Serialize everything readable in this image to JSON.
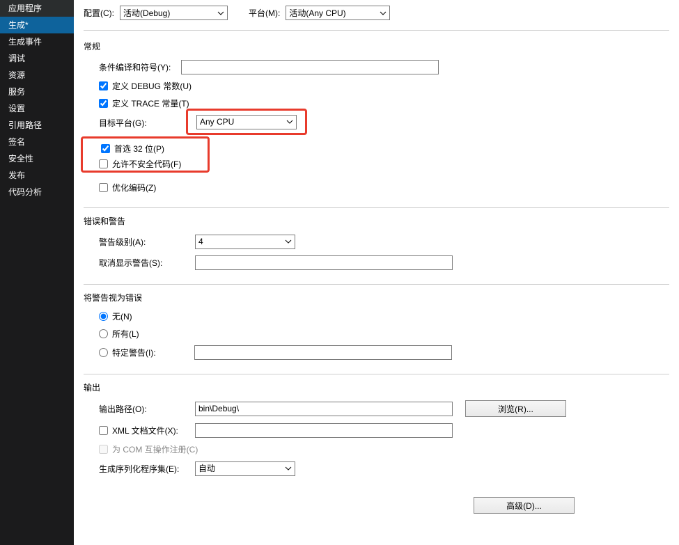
{
  "sidebar": {
    "items": [
      {
        "label": "应用程序"
      },
      {
        "label": "生成*"
      },
      {
        "label": "生成事件"
      },
      {
        "label": "调试"
      },
      {
        "label": "资源"
      },
      {
        "label": "服务"
      },
      {
        "label": "设置"
      },
      {
        "label": "引用路径"
      },
      {
        "label": "签名"
      },
      {
        "label": "安全性"
      },
      {
        "label": "发布"
      },
      {
        "label": "代码分析"
      }
    ]
  },
  "top": {
    "config_label": "配置(C):",
    "config_value": "活动(Debug)",
    "platform_label": "平台(M):",
    "platform_value": "活动(Any CPU)"
  },
  "general": {
    "title": "常规",
    "cond_symbols_label": "条件编译和符号(Y):",
    "cond_symbols_value": "",
    "define_debug": "定义 DEBUG 常数(U)",
    "define_trace": "定义 TRACE 常量(T)",
    "target_platform_label": "目标平台(G):",
    "target_platform_value": "Any CPU",
    "prefer_32bit": "首选 32 位(P)",
    "allow_unsafe": "允许不安全代码(F)",
    "optimize": "优化编码(Z)"
  },
  "warnings": {
    "title": "错误和警告",
    "level_label": "警告级别(A):",
    "level_value": "4",
    "suppress_label": "取消显示警告(S):",
    "suppress_value": ""
  },
  "treat_as_error": {
    "title": "将警告视为错误",
    "none": "无(N)",
    "all": "所有(L)",
    "specific_label": "特定警告(I):",
    "specific_value": ""
  },
  "output": {
    "title": "输出",
    "path_label": "输出路径(O):",
    "path_value": "bin\\Debug\\",
    "browse_btn": "浏览(R)...",
    "xml_doc_label": "XML 文档文件(X):",
    "xml_doc_value": "",
    "register_com": "为 COM 互操作注册(C)",
    "gen_assembly_label": "生成序列化程序集(E):",
    "gen_assembly_value": "自动"
  },
  "advanced_btn": "高级(D)..."
}
